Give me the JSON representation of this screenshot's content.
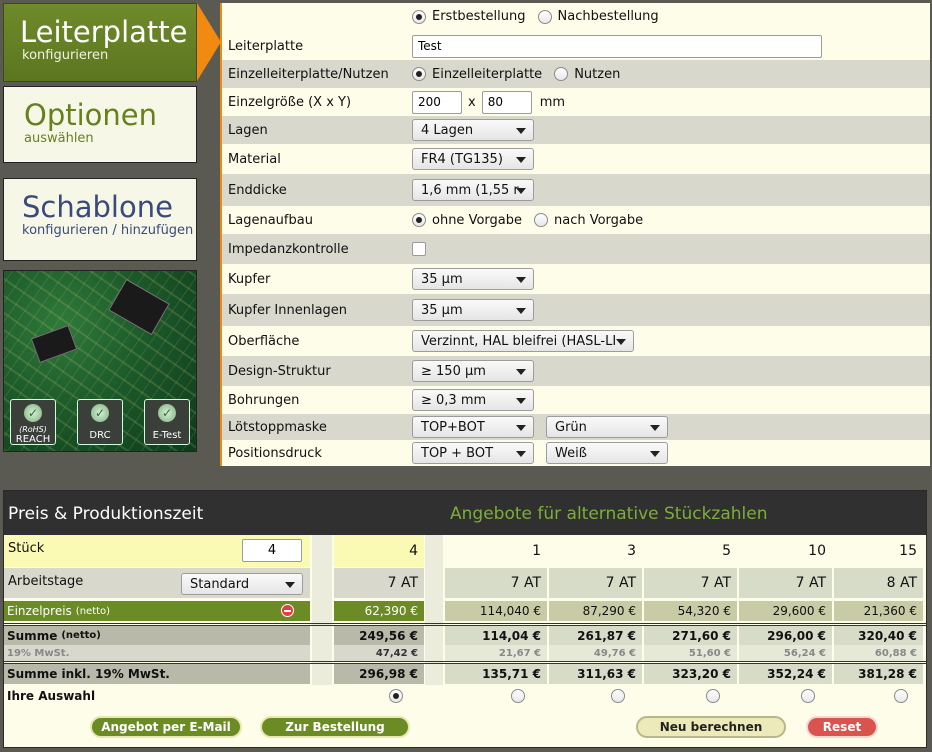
{
  "nav": {
    "items": [
      {
        "title": "Leiterplatte",
        "sub": "konfigurieren"
      },
      {
        "title": "Optionen",
        "sub": "auswählen"
      },
      {
        "title": "Schablone",
        "sub": "konfigurieren / hinzufügen"
      }
    ],
    "badges": [
      "REACH",
      "DRC",
      "E-Test"
    ],
    "rohs_mark": "(RoHS)"
  },
  "form": {
    "order_type": {
      "options": [
        "Erstbestellung",
        "Nachbestellung"
      ],
      "selected": "Erstbestellung"
    },
    "pcb_name": {
      "label": "Leiterplatte",
      "value": "Test"
    },
    "panel": {
      "label": "Einzelleiterplatte/Nutzen",
      "options": [
        "Einzelleiterplatte",
        "Nutzen"
      ],
      "selected": "Einzelleiterplatte"
    },
    "size": {
      "label": "Einzelgröße (X x Y)",
      "x": "200",
      "sep": "x",
      "y": "80",
      "unit": "mm"
    },
    "layers": {
      "label": "Lagen",
      "value": "4 Lagen"
    },
    "material": {
      "label": "Material",
      "value": "FR4 (TG135)"
    },
    "thickness": {
      "label": "Enddicke",
      "value": "1,6 mm (1,55 r"
    },
    "stackup": {
      "label": "Lagenaufbau",
      "options": [
        "ohne Vorgabe",
        "nach Vorgabe"
      ],
      "selected": "ohne Vorgabe"
    },
    "impedance": {
      "label": "Impedanzkontrolle",
      "checked": false
    },
    "copper": {
      "label": "Kupfer",
      "value": "35 µm"
    },
    "copper_inner": {
      "label": "Kupfer Innenlagen",
      "value": "35 µm"
    },
    "surface": {
      "label": "Oberfläche",
      "value": "Verzinnt, HAL bleifrei (HASL-LI"
    },
    "design": {
      "label": "Design-Struktur",
      "value": "≥ 150 µm"
    },
    "drill": {
      "label": "Bohrungen",
      "value": "≥ 0,3 mm"
    },
    "soldermask": {
      "label": "Lötstoppmaske",
      "sides": "TOP+BOT",
      "color": "Grün"
    },
    "legend": {
      "label": "Positionsdruck",
      "sides": "TOP + BOT",
      "color": "Weiß"
    }
  },
  "price": {
    "title": "Preis & Produktionszeit",
    "alt_title": "Angebote für alternative Stückzahlen",
    "labels": {
      "qty": "Stück",
      "workdays": "Arbeitstage",
      "unit_price": "Einzelpreis",
      "unit_price_net": "(netto)",
      "sum": "Summe",
      "sum_net": "(netto)",
      "vat": "19% MwSt.",
      "total": "Summe inkl. 19% MwSt.",
      "choice": "Ihre Auswahl"
    },
    "qty_input": "4",
    "workdays_select": "Standard",
    "main": {
      "qty": "4",
      "days": "7 AT",
      "unit": "62,390 €",
      "sum": "249,56 €",
      "vat": "47,42 €",
      "total": "296,98 €"
    },
    "alternatives": [
      {
        "qty": "1",
        "days": "7 AT",
        "unit": "114,040 €",
        "sum": "114,04 €",
        "vat": "21,67 €",
        "total": "135,71 €"
      },
      {
        "qty": "3",
        "days": "7 AT",
        "unit": "87,290 €",
        "sum": "261,87 €",
        "vat": "49,76 €",
        "total": "311,63 €"
      },
      {
        "qty": "5",
        "days": "7 AT",
        "unit": "54,320 €",
        "sum": "271,60 €",
        "vat": "51,60 €",
        "total": "323,20 €"
      },
      {
        "qty": "10",
        "days": "7 AT",
        "unit": "29,600 €",
        "sum": "296,00 €",
        "vat": "56,24 €",
        "total": "352,24 €"
      },
      {
        "qty": "15",
        "days": "8 AT",
        "unit": "21,360 €",
        "sum": "320,40 €",
        "vat": "60,88 €",
        "total": "381,28 €"
      }
    ],
    "buttons": {
      "email": "Angebot per E-Mail",
      "order": "Zur Bestellung",
      "recalc": "Neu berechnen",
      "reset": "Reset"
    }
  },
  "colors": {
    "accent": "#f08a10",
    "brand_green": "#6b8b24",
    "alt_title": "#7cae3a",
    "reset": "#d9534f"
  }
}
